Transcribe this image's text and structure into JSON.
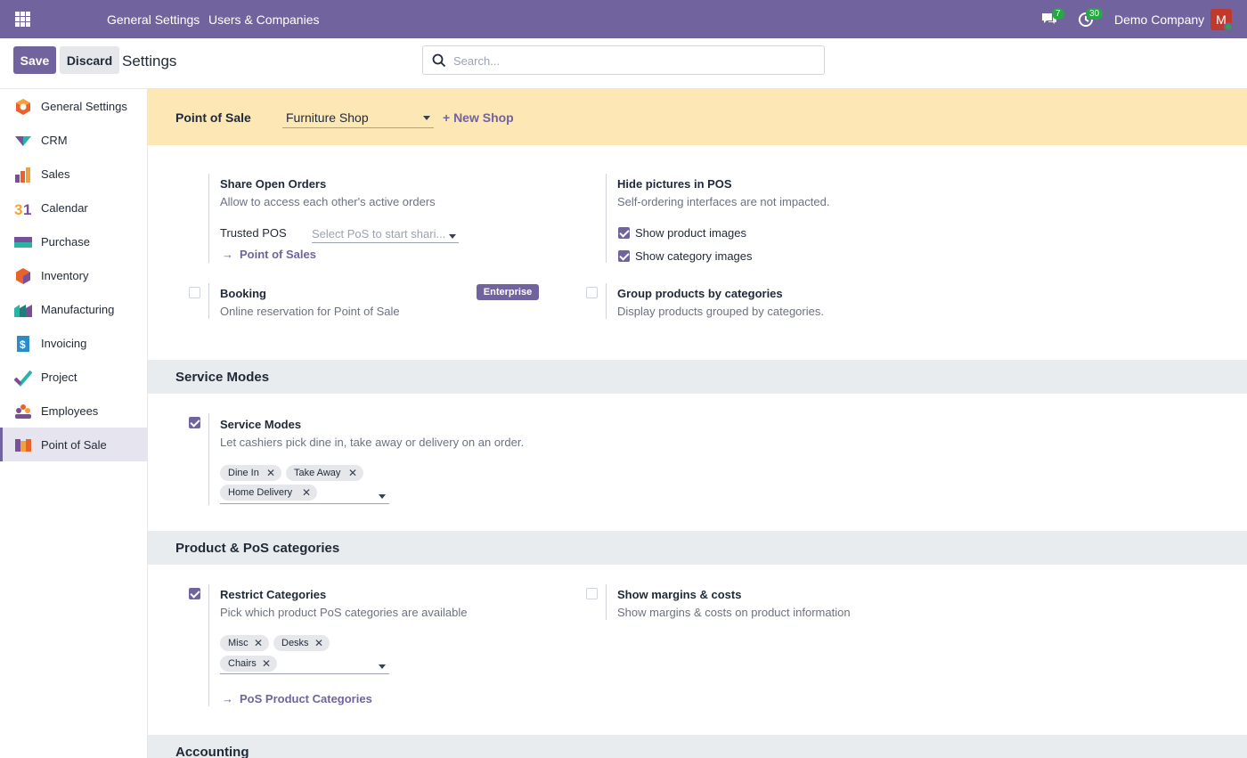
{
  "topbar": {
    "nav": [
      "General Settings",
      "Users & Companies"
    ],
    "messages_count": "7",
    "activities_count": "30",
    "company": "Demo Company",
    "avatar_letter": "M"
  },
  "control": {
    "save_label": "Save",
    "discard_label": "Discard",
    "title": "Settings",
    "search_placeholder": "Search..."
  },
  "sidebar": {
    "items": [
      {
        "label": "General Settings",
        "icon": "general-settings-icon"
      },
      {
        "label": "CRM",
        "icon": "crm-icon"
      },
      {
        "label": "Sales",
        "icon": "sales-icon"
      },
      {
        "label": "Calendar",
        "icon": "calendar-icon"
      },
      {
        "label": "Purchase",
        "icon": "purchase-icon"
      },
      {
        "label": "Inventory",
        "icon": "inventory-icon"
      },
      {
        "label": "Manufacturing",
        "icon": "manufacturing-icon"
      },
      {
        "label": "Invoicing",
        "icon": "invoicing-icon"
      },
      {
        "label": "Project",
        "icon": "project-icon"
      },
      {
        "label": "Employees",
        "icon": "employees-icon"
      },
      {
        "label": "Point of Sale",
        "icon": "point-of-sale-icon"
      }
    ],
    "active": "Point of Sale"
  },
  "pos_bar": {
    "label": "Point of Sale",
    "shop": "Furniture Shop",
    "new_shop": "+ New Shop"
  },
  "settings": {
    "share_orders": {
      "title": "Share Open Orders",
      "desc": "Allow to access each other's active orders",
      "trusted_label": "Trusted POS",
      "trusted_placeholder": "Select PoS to start shari...",
      "link": "Point of Sales"
    },
    "hide_pictures": {
      "title": "Hide pictures in POS",
      "desc": "Self-ordering interfaces are not impacted.",
      "opt1": "Show product images",
      "opt1_checked": true,
      "opt2": "Show category images",
      "opt2_checked": true
    },
    "booking": {
      "title": "Booking",
      "desc": "Online reservation for Point of Sale",
      "badge": "Enterprise",
      "checked": false
    },
    "group_products": {
      "title": "Group products by categories",
      "desc": "Display products grouped by categories.",
      "checked": false
    }
  },
  "service_modes": {
    "header": "Service Modes",
    "title": "Service Modes",
    "desc": "Let cashiers pick dine in, take away or delivery on an order.",
    "checked": true,
    "tags": [
      "Dine In",
      "Take Away",
      "Home Delivery"
    ]
  },
  "categories": {
    "header": "Product & PoS categories",
    "restrict": {
      "title": "Restrict Categories",
      "desc": "Pick which product PoS categories are available",
      "checked": true,
      "tags": [
        "Misc",
        "Desks",
        "Chairs"
      ],
      "link": "PoS Product Categories"
    },
    "margins": {
      "title": "Show margins & costs",
      "desc": "Show margins & costs on product information",
      "checked": false
    }
  },
  "accounting": {
    "header": "Accounting"
  },
  "colors": {
    "brand": "#71639e",
    "pos_bar": "#fde7b5",
    "badge_green": "#28a745"
  }
}
